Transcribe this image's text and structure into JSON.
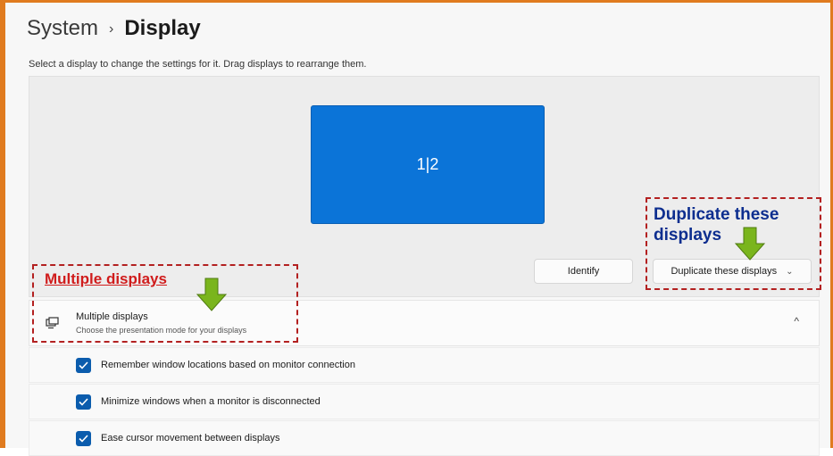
{
  "breadcrumb": {
    "parent": "System",
    "separator": "›",
    "current": "Display"
  },
  "subtitle": "Select a display to change the settings for it. Drag displays to rearrange them.",
  "monitor_label": "1|2",
  "buttons": {
    "identify": "Identify",
    "duplicate": "Duplicate these displays"
  },
  "section": {
    "icon": "multiple-monitors-icon",
    "title": "Multiple displays",
    "description": "Choose the presentation mode for your displays",
    "chevron": "^",
    "options": [
      {
        "label": "Remember window locations based on monitor connection",
        "checked": true
      },
      {
        "label": "Minimize windows when a monitor is disconnected",
        "checked": true
      },
      {
        "label": "Ease cursor movement between displays",
        "checked": true
      }
    ]
  },
  "annotations": {
    "left_text": "Multiple displays",
    "right_text_line1": "Duplicate these",
    "right_text_line2": "displays"
  },
  "colors": {
    "frame": "#e07b1f",
    "monitor": "#0b74d8",
    "checkbox": "#0b5cad",
    "annotation_red": "#d01c1c",
    "annotation_blue": "#0d2e8f",
    "arrow_green": "#7ab51d"
  }
}
